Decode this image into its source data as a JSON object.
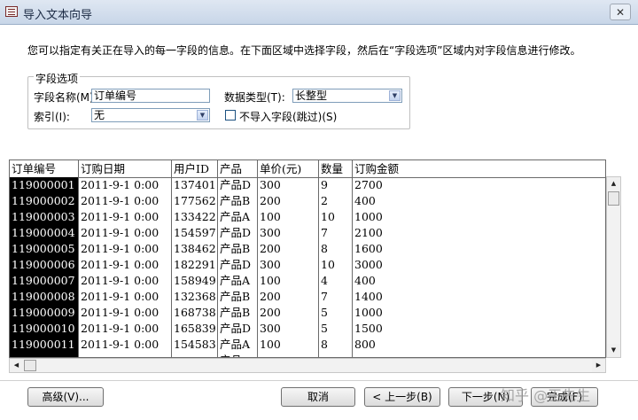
{
  "window": {
    "title": "导入文本向导",
    "close_label": "✕"
  },
  "intro_text": "您可以指定有关正在导入的每一字段的信息。在下面区域中选择字段，然后在“字段选项”区域内对字段信息进行修改。",
  "field_options": {
    "legend": "字段选项",
    "field_name_label": "字段名称(M):",
    "field_name_value": "订单编号",
    "data_type_label": "数据类型(T):",
    "data_type_value": "长整型",
    "index_label": "索引(I):",
    "index_value": "无",
    "skip_label": "不导入字段(跳过)(S)",
    "skip_checked": false
  },
  "table": {
    "columns": [
      "订单编号",
      "订购日期",
      "用户ID",
      "产品",
      "单价(元)",
      "数量",
      "订购金额"
    ],
    "rows": [
      [
        "119000001",
        "2011-9-1 0:00",
        "137401",
        "产品D",
        "300",
        "9",
        "2700"
      ],
      [
        "119000002",
        "2011-9-1 0:00",
        "177562",
        "产品B",
        "200",
        "2",
        "400"
      ],
      [
        "119000003",
        "2011-9-1 0:00",
        "133422",
        "产品A",
        "100",
        "10",
        "1000"
      ],
      [
        "119000004",
        "2011-9-1 0:00",
        "154597",
        "产品D",
        "300",
        "7",
        "2100"
      ],
      [
        "119000005",
        "2011-9-1 0:00",
        "138462",
        "产品B",
        "200",
        "8",
        "1600"
      ],
      [
        "119000006",
        "2011-9-1 0:00",
        "182291",
        "产品D",
        "300",
        "10",
        "3000"
      ],
      [
        "119000007",
        "2011-9-1 0:00",
        "158949",
        "产品A",
        "100",
        "4",
        "400"
      ],
      [
        "119000008",
        "2011-9-1 0:00",
        "132368",
        "产品B",
        "200",
        "7",
        "1400"
      ],
      [
        "119000009",
        "2011-9-1 0:00",
        "168738",
        "产品B",
        "200",
        "5",
        "1000"
      ],
      [
        "119000010",
        "2011-9-1 0:00",
        "165839",
        "产品D",
        "300",
        "5",
        "1500"
      ],
      [
        "119000011",
        "2011-9-1 0:00",
        "154583",
        "产品A",
        "100",
        "8",
        "800"
      ]
    ],
    "partial_row_text": "产品"
  },
  "buttons": {
    "advanced": "高级(V)...",
    "cancel": "取消",
    "back": "< 上一步(B)",
    "next": "下一步(N)",
    "finish": "完成(F)"
  },
  "watermark": "知乎 @王先生",
  "icons": {
    "title": "import-text-wizard-icon",
    "dropdown": "chevron-down-icon",
    "scroll_up": "arrow-up-icon",
    "scroll_down": "arrow-down-icon",
    "scroll_left": "arrow-left-icon",
    "scroll_right": "arrow-right-icon"
  }
}
